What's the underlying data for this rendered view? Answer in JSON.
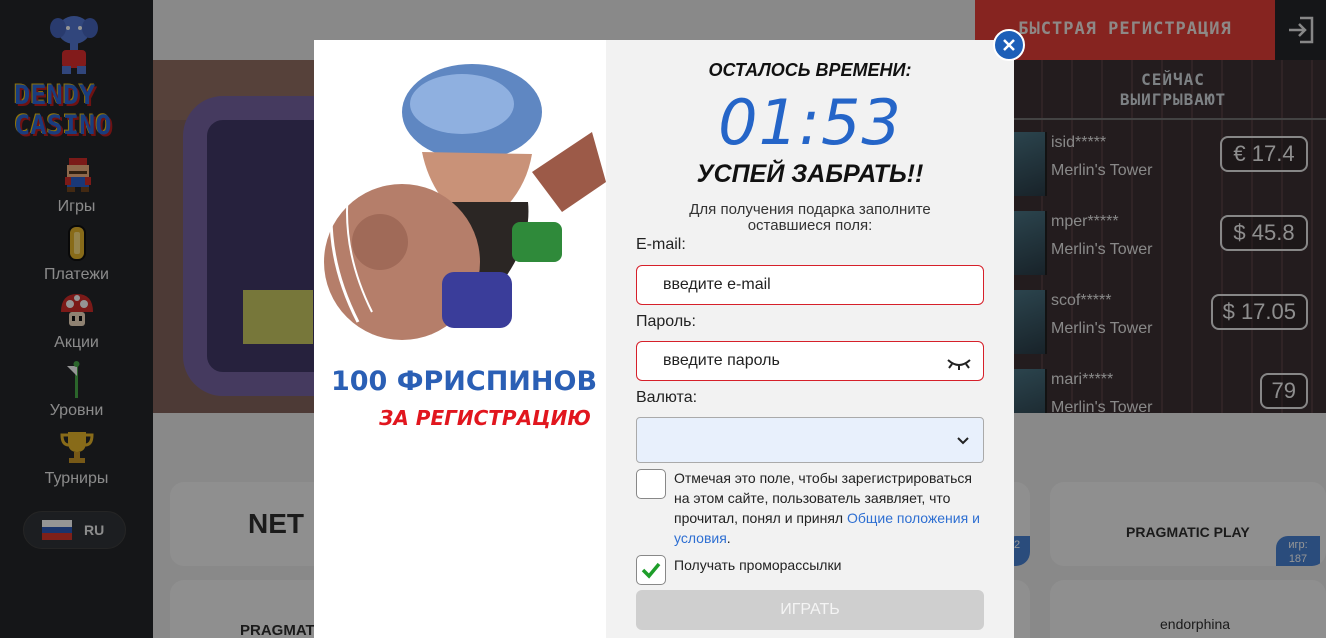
{
  "brand": {
    "line1": "DENDY",
    "line2": "CASINO"
  },
  "sidebar": {
    "items": [
      {
        "label": "Игры",
        "icon": "mario-icon"
      },
      {
        "label": "Платежи",
        "icon": "coin-icon"
      },
      {
        "label": "Акции",
        "icon": "mushroom-icon"
      },
      {
        "label": "Уровни",
        "icon": "flag-icon"
      },
      {
        "label": "Турниры",
        "icon": "trophy-icon"
      }
    ],
    "language": "RU"
  },
  "header": {
    "quick_registration": "БЫСТРАЯ РЕГИСТРАЦИЯ",
    "login_icon": "login-icon"
  },
  "winners": {
    "title_line1": "СЕЙЧАС",
    "title_line2": "ВЫИГРЫВАЮТ",
    "rows": [
      {
        "user": "isid*****",
        "game": "Merlin's Tower",
        "amount": "€ 17.4"
      },
      {
        "user": "mper*****",
        "game": "Merlin's Tower",
        "amount": "$ 45.8"
      },
      {
        "user": "scof*****",
        "game": "Merlin's Tower",
        "amount": "$ 17.05"
      },
      {
        "user": "mari*****",
        "game": "Merlin's Tower",
        "amount": "79"
      }
    ]
  },
  "providers": [
    {
      "name": "NET",
      "count_label": "",
      "count": ""
    },
    {
      "name": "PRAGMATIC PLAY",
      "count_label": "игр:",
      "count": "187"
    },
    {
      "name": "PRAGMAT",
      "count_label": "",
      "count": ""
    },
    {
      "name": "endorphina",
      "count_label": "",
      "count": ""
    }
  ],
  "provider_partial_count": "2",
  "modal": {
    "promo_line1": "100 ФРИСПИНОВ",
    "promo_line2": "ЗА РЕГИСТРАЦИЮ",
    "timer_label": "ОСТАЛОСЬ ВРЕМЕНИ:",
    "timer": "01:53",
    "cta": "УСПЕЙ ЗАБРАТЬ!!",
    "subtitle": "Для получения подарка заполните оставшиеся поля:",
    "email_label": "E-mail:",
    "email_placeholder": "введите e-mail",
    "password_label": "Пароль:",
    "password_placeholder": "введите пароль",
    "currency_label": "Валюта:",
    "currency_value": "",
    "terms_text": "Отмечая это поле, чтобы зарегистрироваться на этом сайте, пользователь заявляет, что прочитал, понял и принял ",
    "terms_link": "Общие положения и условия",
    "terms_end": ".",
    "terms_checked": false,
    "promo_checkbox_label": "Получать проморассылки",
    "promo_checked": true,
    "play_button": "ИГРАТЬ"
  },
  "colors": {
    "accent_blue": "#2565c8",
    "accent_red": "#e3322b",
    "sidebar_bg": "#16181c",
    "check_green": "#1e9e2a"
  }
}
